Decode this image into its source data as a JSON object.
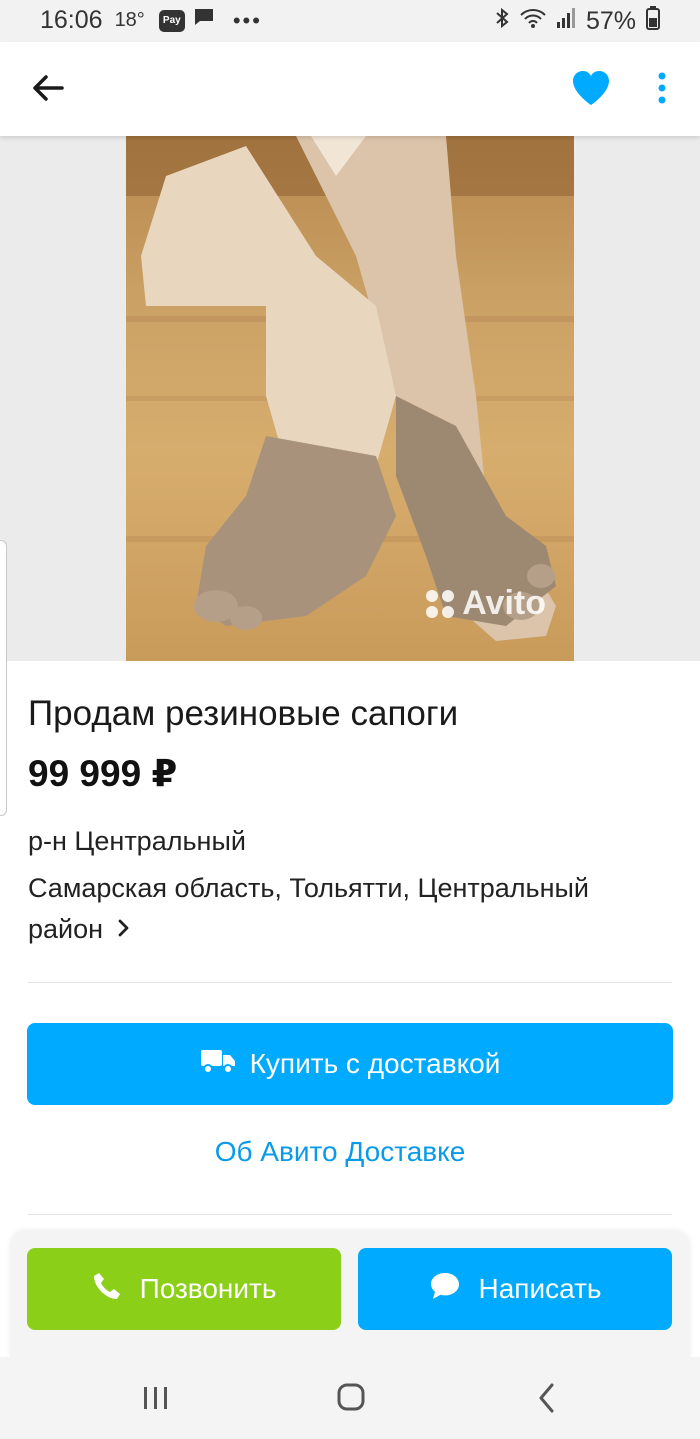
{
  "status_bar": {
    "time": "16:06",
    "temperature": "18°",
    "pay_label": "Pay",
    "battery": "57%"
  },
  "app_bar": {
    "icons": {
      "back": "arrow-left-icon",
      "favorite": "heart-icon",
      "more": "more-vertical-icon"
    },
    "accent_color": "#00aaff"
  },
  "photo": {
    "watermark": "Avito"
  },
  "listing": {
    "title": "Продам резиновые сапоги",
    "price": "99 999 ₽",
    "district": "р-н Центральный",
    "address": "Самарская область, Тольятти, Центральный район"
  },
  "actions": {
    "buy_delivery": "Купить с доставкой",
    "about_delivery": "Об Авито Доставке",
    "call": "Позвонить",
    "write": "Написать",
    "colors": {
      "call": "#8bcf19",
      "primary": "#00aaff"
    }
  }
}
